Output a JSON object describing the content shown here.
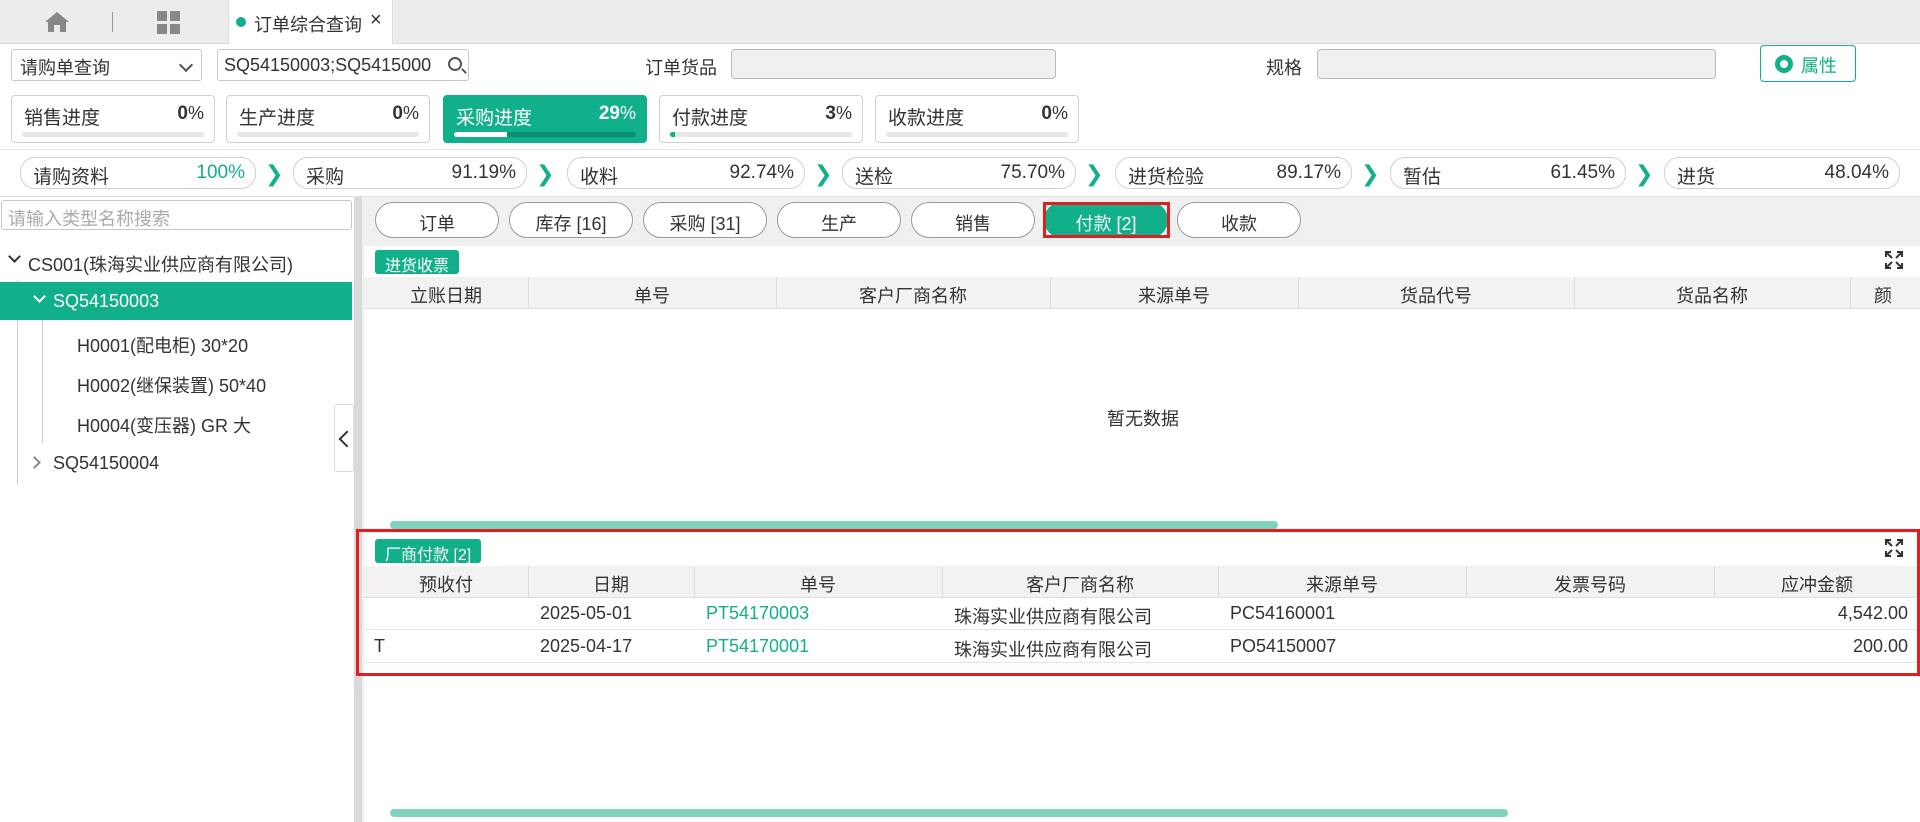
{
  "tabs": {
    "active_label": "订单综合查询"
  },
  "filters": {
    "query_type": "请购单查询",
    "search_value": "SQ54150003;SQ5415000",
    "goods_label": "订单货品",
    "spec_label": "规格",
    "attr_button": "属性"
  },
  "progress": [
    {
      "label": "销售进度",
      "value": "0",
      "unit": "%",
      "fraction": 0.0,
      "active": false
    },
    {
      "label": "生产进度",
      "value": "0",
      "unit": "%",
      "fraction": 0.0,
      "active": false
    },
    {
      "label": "采购进度",
      "value": "29",
      "unit": "%",
      "fraction": 0.29,
      "active": true
    },
    {
      "label": "付款进度",
      "value": "3",
      "unit": "%",
      "fraction": 0.03,
      "active": false
    },
    {
      "label": "收款进度",
      "value": "0",
      "unit": "%",
      "fraction": 0.0,
      "active": false
    }
  ],
  "steps": [
    {
      "label": "请购资料",
      "value": "100%",
      "accent": true
    },
    {
      "label": "采购",
      "value": "91.19%"
    },
    {
      "label": "收料",
      "value": "92.74%"
    },
    {
      "label": "送检",
      "value": "75.70%"
    },
    {
      "label": "进货检验",
      "value": "89.17%"
    },
    {
      "label": "暂估",
      "value": "61.45%"
    },
    {
      "label": "进货",
      "value": "48.04%"
    }
  ],
  "tree": {
    "search_placeholder": "请输入类型名称搜索",
    "root": "CS001(珠海实业供应商有限公司)",
    "selected": "SQ54150003",
    "children": [
      "H0001(配电柜) 30*20",
      "H0002(继保装置) 50*40",
      "H0004(变压器) GR 大"
    ],
    "sibling": "SQ54150004"
  },
  "pills": [
    "订单",
    "库存 [16]",
    "采购 [31]",
    "生产",
    "销售",
    "付款 [2]",
    "收款"
  ],
  "panel1": {
    "title": "进货收票",
    "columns": [
      "立账日期",
      "单号",
      "客户厂商名称",
      "来源单号",
      "货品代号",
      "货品名称",
      "颜"
    ],
    "empty_text": "暂无数据"
  },
  "panel2": {
    "title": "厂商付款 [2]",
    "columns": [
      "预收付",
      "日期",
      "单号",
      "客户厂商名称",
      "来源单号",
      "发票号码",
      "应冲金额"
    ],
    "rows": [
      {
        "prepay": "",
        "date": "2025-05-01",
        "no": "PT54170003",
        "vendor": "珠海实业供应商有限公司",
        "source": "PC54160001",
        "invoice": "",
        "amount": "4,542.00"
      },
      {
        "prepay": "T",
        "date": "2025-04-17",
        "no": "PT54170001",
        "vendor": "珠海实业供应商有限公司",
        "source": "PO54150007",
        "invoice": "",
        "amount": "200.00"
      }
    ]
  },
  "colors": {
    "accent": "#11b08a",
    "highlight": "#e02020"
  }
}
